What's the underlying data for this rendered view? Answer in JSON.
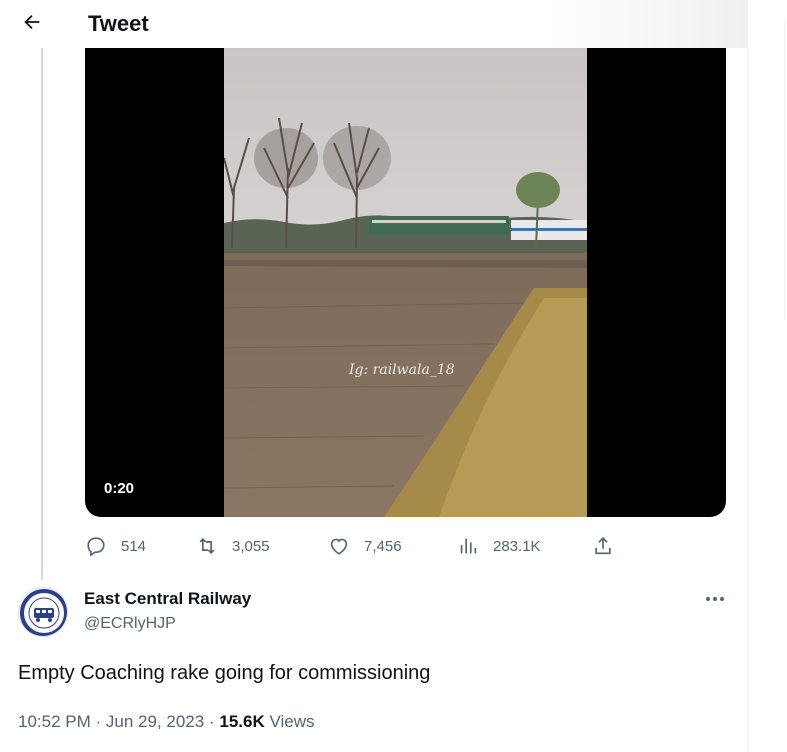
{
  "header": {
    "title": "Tweet"
  },
  "media": {
    "duration": "0:20",
    "watermark": "Ig: railwala_18"
  },
  "actions": {
    "replies": "514",
    "retweets": "3,055",
    "likes": "7,456",
    "views": "283.1K"
  },
  "author": {
    "name": "East Central Railway",
    "handle": "@ECRlyHJP"
  },
  "tweet": {
    "text": "Empty Coaching rake going for commissioning",
    "time": "10:52 PM",
    "date": "Jun 29, 2023",
    "views_count": "15.6K",
    "views_label": "Views",
    "separator": "·"
  },
  "icons": {
    "back": "arrow-left-icon",
    "reply": "reply-icon",
    "retweet": "retweet-icon",
    "like": "heart-icon",
    "views": "views-chart-icon",
    "share": "share-icon",
    "more": "more-icon"
  },
  "colors": {
    "text": "#0f1419",
    "secondary": "#536471",
    "thread_line": "#cfd9de"
  }
}
